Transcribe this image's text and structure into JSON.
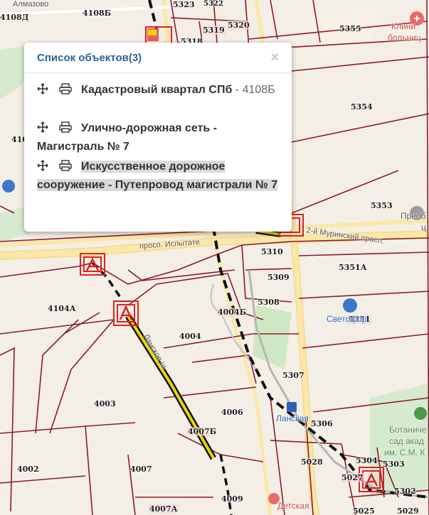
{
  "map": {
    "parcels": [
      "5323",
      "5322",
      "5319",
      "5320",
      "5318",
      "4108Б",
      "4108Д",
      "5355",
      "5354",
      "5353",
      "5310",
      "5309",
      "5308",
      "5351А",
      "5351",
      "5307",
      "5306",
      "5304",
      "5303",
      "5302",
      "5027",
      "5028",
      "5025",
      "5029",
      "4104А",
      "4004",
      "4004Б",
      "4003",
      "4006",
      "4007Б",
      "4007",
      "4007А",
      "4009",
      "4002",
      "410"
    ],
    "pois": {
      "clinic_1": "Клини",
      "clinic_2": "больниц",
      "preob_1": "Преоб",
      "preob_2": "ц",
      "svetofor": "Светофор",
      "botanic_1": "Ботаниче",
      "botanic_2": "сад акад",
      "botanic_2b": "им. С.М. К",
      "detskaya": "Детская",
      "almazovo": "Алмазово",
      "lanskaya": "Ланская"
    },
    "roads": {
      "ispytateley": "просп. Испытате",
      "murinsky": "2-й Муринский просп.",
      "lanskoe": "Ланское ш."
    },
    "colors": {
      "parcel_border": "#8b1a2e",
      "road_yellow": "#fbe39a",
      "highlight_route": "#e8d800",
      "marker": "#e02020",
      "green": "#cfe8c4"
    }
  },
  "popup": {
    "title": "Список объектов(3)",
    "close_label": "×",
    "items": [
      {
        "name": "Кадастровый квартал СПб",
        "value": " - 4108Б",
        "icons": [
          "move-icon",
          "print-icon"
        ]
      },
      {
        "name": "Улично-дорожная сеть - Магистраль № 7",
        "value": "",
        "icons": [
          "move-icon",
          "print-icon"
        ]
      },
      {
        "name": "Искусственное дорожное сооружение - Путепровод магистрали № 7",
        "value": "",
        "icons": [
          "move-icon",
          "print-icon"
        ]
      }
    ]
  }
}
